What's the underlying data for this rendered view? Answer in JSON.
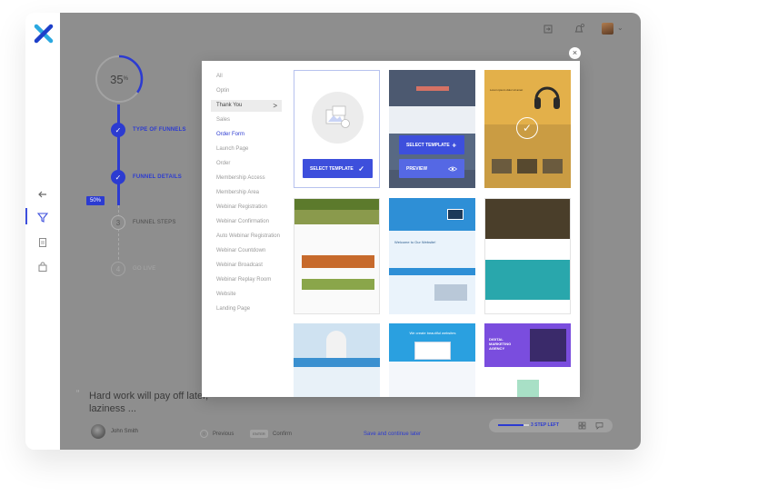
{
  "progress": {
    "overall_percent": 35,
    "overall_label": "35",
    "overall_unit": "%",
    "current_step_percent": 50,
    "current_step_label": "50%"
  },
  "steps": [
    {
      "number": "1",
      "label": "TYPE OF FUNNELS",
      "state": "done"
    },
    {
      "number": "2",
      "label": "FUNNEL DETAILS",
      "state": "done"
    },
    {
      "number": "3",
      "label": "FUNNEL STEPS",
      "state": "todo"
    },
    {
      "number": "4",
      "label": "GO LIVE",
      "state": "dim"
    }
  ],
  "quote": {
    "mark": "“",
    "text": "Hard work will pay off later, laziness ...",
    "author": "John Smith"
  },
  "footer": {
    "previous_label": "Previous",
    "enter_key_label": "ENTER",
    "confirm_label": "Confirm",
    "save_later_label": "Save and continue later",
    "steps_left_label": "3 STEP LEFT"
  },
  "modal": {
    "close_glyph": "×",
    "categories": [
      {
        "label": "All",
        "state": "normal"
      },
      {
        "label": "Optin",
        "state": "normal"
      },
      {
        "label": "Thank You",
        "state": "selected"
      },
      {
        "label": "Sales",
        "state": "normal"
      },
      {
        "label": "Order Form",
        "state": "highlight"
      },
      {
        "label": "Launch Page",
        "state": "normal"
      },
      {
        "label": "Order",
        "state": "normal"
      },
      {
        "label": "Membership Access",
        "state": "normal"
      },
      {
        "label": "Membership Area",
        "state": "normal"
      },
      {
        "label": "Webinar Registration",
        "state": "normal"
      },
      {
        "label": "Webinar Confirmation",
        "state": "normal"
      },
      {
        "label": "Auto Webinar Registration",
        "state": "normal"
      },
      {
        "label": "Webinar Countdown",
        "state": "normal"
      },
      {
        "label": "Webinar Broadcast",
        "state": "normal"
      },
      {
        "label": "Webinar Replay Room",
        "state": "normal"
      },
      {
        "label": "Website",
        "state": "normal"
      },
      {
        "label": "Landing Page",
        "state": "normal"
      }
    ],
    "selected_chevron": ">",
    "blank_card": {
      "button_label": "SELECT TEMPLATE",
      "button_icon": "check-icon"
    },
    "hover_card": {
      "select_label": "SELECT TEMPLATE",
      "select_icon": "plus-icon",
      "preview_label": "PREVIEW",
      "preview_icon": "eye-icon"
    },
    "template_texts": {
      "headphones_title": "Lorem ipsum dolor sit amet",
      "blue_site_heading": "Welcome to Our Website!",
      "blue_banner_heading": "We create beautiful websites",
      "digital_agency_title": "DIGITAL MARKETING AGENCY"
    }
  },
  "colors": {
    "accent": "#2c3bd1",
    "button": "#3d4fdc",
    "overlay_gray": "#8e8e8e",
    "teal": "#29a7ac",
    "sky": "#2e8fd6",
    "purple": "#7a4dde"
  }
}
